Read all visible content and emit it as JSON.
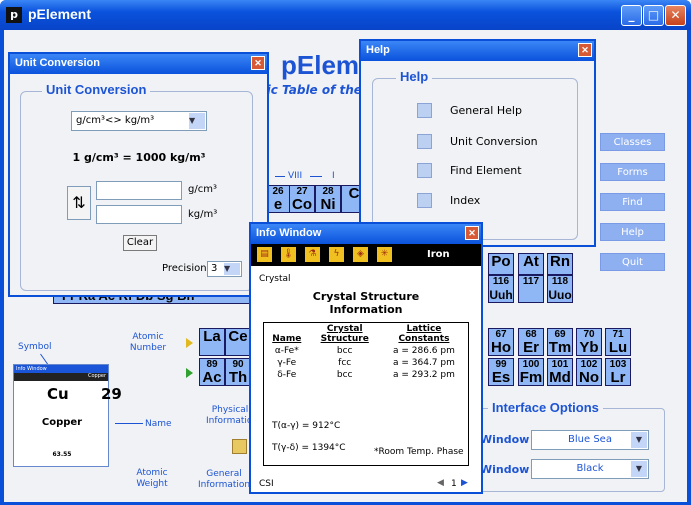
{
  "app": {
    "title": "pElement",
    "icon_letter": "p",
    "logo": "pEleme",
    "subtitle": "dic Table of the"
  },
  "window_buttons": [
    "_",
    "□",
    "✕"
  ],
  "side_buttons": [
    "Classes",
    "Forms",
    "Find",
    "Help",
    "Quit"
  ],
  "groups": {
    "viii": "VIII",
    "i": "I"
  },
  "cells": [
    {
      "n": "26",
      "s": "e"
    },
    {
      "n": "27",
      "s": "Co"
    },
    {
      "n": "28",
      "s": "Ni"
    },
    {
      "n": "",
      "s": "C"
    },
    {
      "n": "",
      "s": "Po"
    },
    {
      "n": "",
      "s": "At"
    },
    {
      "n": "",
      "s": "Rn"
    },
    {
      "n": "116",
      "s": "Uuh"
    },
    {
      "n": "117",
      "s": ""
    },
    {
      "n": "118",
      "s": "Uuo"
    },
    {
      "n": "",
      "s": "La"
    },
    {
      "n": "",
      "s": "Ce"
    },
    {
      "n": "67",
      "s": "Ho"
    },
    {
      "n": "68",
      "s": "Er"
    },
    {
      "n": "69",
      "s": "Tm"
    },
    {
      "n": "70",
      "s": "Yb"
    },
    {
      "n": "71",
      "s": "Lu"
    },
    {
      "n": "89",
      "s": "Ac"
    },
    {
      "n": "90",
      "s": "Th"
    },
    {
      "n": "99",
      "s": "Es"
    },
    {
      "n": "100",
      "s": "Fm"
    },
    {
      "n": "101",
      "s": "Md"
    },
    {
      "n": "102",
      "s": "No"
    },
    {
      "n": "103",
      "s": "Lr"
    }
  ],
  "bottom_row": "Fr Ra Ac Rf Db Sg Bh",
  "legend": {
    "symbol": "Symbol",
    "atomic_number": "Atomic\nNumber",
    "name": "Name",
    "atomic_weight": "Atomic\nWeight",
    "physical": "Physical\nInformation",
    "general": "General\nInformation"
  },
  "info_card": {
    "title": "Info Window",
    "tag": "Copper",
    "symbol": "Cu",
    "number": "29",
    "name": "Copper",
    "weight": "63.55"
  },
  "interface_options": {
    "title": "Interface Options",
    "row1_label": "Window",
    "row1_value": "Blue Sea",
    "row2_label": "Window",
    "row2_value": "Black"
  },
  "unit_dialog": {
    "title": "Unit Conversion",
    "legend": "Unit Conversion",
    "select": "g/cm³<> kg/m³",
    "equation": "1 g/cm³ = 1000 kg/m³",
    "unit1": "g/cm³",
    "unit2": "kg/m³",
    "clear": "Clear",
    "precision_label": "Precision",
    "precision_value": "3"
  },
  "help_dialog": {
    "title": "Help",
    "legend": "Help",
    "items": [
      "General Help",
      "Unit Conversion",
      "Find Element",
      "Index"
    ]
  },
  "info_window": {
    "title": "Info Window",
    "element": "Iron",
    "tab": "Crystal",
    "heading": "Crystal Structure\nInformation",
    "columns": [
      "Name",
      "Crystal\nStructure",
      "Lattice\nConstants"
    ],
    "rows": [
      {
        "name": "α-Fe*",
        "structure": "bcc",
        "constant": "a = 286.6 pm"
      },
      {
        "name": "γ-Fe",
        "structure": "fcc",
        "constant": "a = 364.7 pm"
      },
      {
        "name": "δ-Fe",
        "structure": "bcc",
        "constant": "a = 293.2 pm"
      }
    ],
    "t1": "T(α-γ) = 912°C",
    "t2": "T(γ-δ) = 1394°C",
    "note": "*Room Temp. Phase",
    "footer": "CSI",
    "page": "1"
  }
}
